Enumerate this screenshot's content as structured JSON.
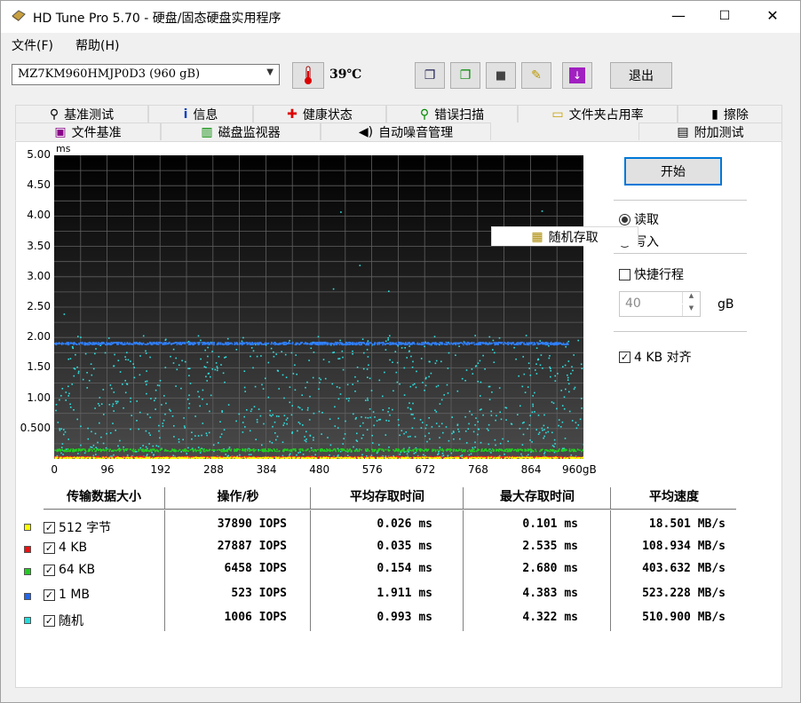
{
  "window": {
    "title": "HD Tune Pro 5.70 - 硬盘/固态硬盘实用程序",
    "min": "—",
    "max": "☐",
    "close": "✕"
  },
  "menu": {
    "file": "文件(F)",
    "help": "帮助(H)"
  },
  "toolbar": {
    "drive": "MZ7KM960HMJP0D3 (960 gB)",
    "temperature": "39℃",
    "exit": "退出"
  },
  "tabs": {
    "row1": [
      "基准测试",
      "信息",
      "健康状态",
      "错误扫描",
      "文件夹占用率",
      "擦除"
    ],
    "row2": [
      "文件基准",
      "磁盘监视器",
      "自动噪音管理",
      "随机存取",
      "附加测试"
    ],
    "active": "随机存取"
  },
  "chart_data": {
    "type": "scatter",
    "ylabel": "ms",
    "xlabel": "",
    "ylim": [
      0,
      5
    ],
    "xlim": [
      0,
      960
    ],
    "y_ticks": [
      "5.00",
      "4.50",
      "4.00",
      "3.50",
      "3.00",
      "2.50",
      "2.00",
      "1.50",
      "1.00",
      "0.500"
    ],
    "x_ticks": [
      "0",
      "96",
      "192",
      "288",
      "384",
      "480",
      "576",
      "672",
      "768",
      "864",
      "960gB"
    ],
    "series": [
      {
        "name": "512 字节",
        "color": "#ffff00",
        "level": 0.026
      },
      {
        "name": "4 KB",
        "color": "#ff2020",
        "level": 0.035
      },
      {
        "name": "64 KB",
        "color": "#20d020",
        "level": 0.154
      },
      {
        "name": "1 MB",
        "color": "#3080ff",
        "level": 1.911
      },
      {
        "name": "随机",
        "color": "#30e0e0",
        "level": 0.993
      }
    ]
  },
  "controls": {
    "start": "开始",
    "read": "读取",
    "write": "写入",
    "quick": "快捷行程",
    "quick_value": "40",
    "unit": "gB",
    "align": "4 KB 对齐"
  },
  "table": {
    "headers": [
      "传输数据大小",
      "操作/秒",
      "平均存取时间",
      "最大存取时间",
      "平均速度"
    ],
    "rows": [
      {
        "label": "512 字节",
        "color": "#ffff00",
        "ops": "37890 IOPS",
        "avg": "0.026 ms",
        "max": "0.101 ms",
        "speed": "18.501 MB/s"
      },
      {
        "label": "4 KB",
        "color": "#ee1111",
        "ops": "27887 IOPS",
        "avg": "0.035 ms",
        "max": "2.535 ms",
        "speed": "108.934 MB/s"
      },
      {
        "label": "64 KB",
        "color": "#22cc22",
        "ops": "6458 IOPS",
        "avg": "0.154 ms",
        "max": "2.680 ms",
        "speed": "403.632 MB/s"
      },
      {
        "label": "1 MB",
        "color": "#2266ee",
        "ops": "523 IOPS",
        "avg": "1.911 ms",
        "max": "4.383 ms",
        "speed": "523.228 MB/s"
      },
      {
        "label": "随机",
        "color": "#22dddd",
        "ops": "1006 IOPS",
        "avg": "0.993 ms",
        "max": "4.322 ms",
        "speed": "510.900 MB/s"
      }
    ]
  }
}
